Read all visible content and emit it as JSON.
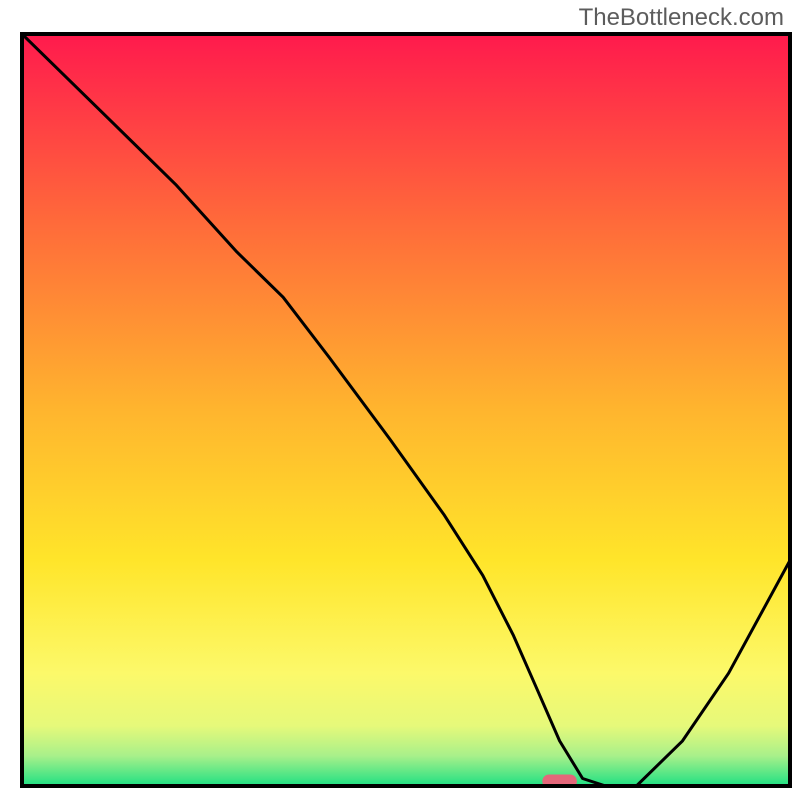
{
  "watermark": "TheBottleneck.com",
  "chart_data": {
    "type": "line",
    "title": "",
    "xlabel": "",
    "ylabel": "",
    "xlim": [
      0,
      100
    ],
    "ylim": [
      0,
      100
    ],
    "background": {
      "type": "vertical_gradient",
      "stops": [
        {
          "offset": 0.0,
          "color": "#ff1a4d"
        },
        {
          "offset": 0.25,
          "color": "#ff6a3a"
        },
        {
          "offset": 0.5,
          "color": "#ffb52e"
        },
        {
          "offset": 0.7,
          "color": "#ffe52a"
        },
        {
          "offset": 0.85,
          "color": "#fcf96a"
        },
        {
          "offset": 0.92,
          "color": "#e6f97a"
        },
        {
          "offset": 0.96,
          "color": "#a8f08a"
        },
        {
          "offset": 1.0,
          "color": "#1fe083"
        }
      ]
    },
    "series": [
      {
        "name": "bottleneck_curve",
        "color": "#000000",
        "stroke_width": 3,
        "x": [
          0,
          5,
          12,
          20,
          28,
          34,
          40,
          48,
          55,
          60,
          64,
          67,
          70,
          73,
          76,
          80,
          86,
          92,
          100
        ],
        "y": [
          100,
          95,
          88,
          80,
          71,
          65,
          57,
          46,
          36,
          28,
          20,
          13,
          6,
          1,
          0,
          0,
          6,
          15,
          30
        ]
      }
    ],
    "marker": {
      "name": "optimal_point",
      "shape": "rounded_rect",
      "x": 70,
      "y": 0,
      "width_frac": 0.045,
      "height_frac": 0.018,
      "color": "#e4677a"
    },
    "frame": {
      "color": "#000000",
      "stroke_width": 4
    }
  }
}
